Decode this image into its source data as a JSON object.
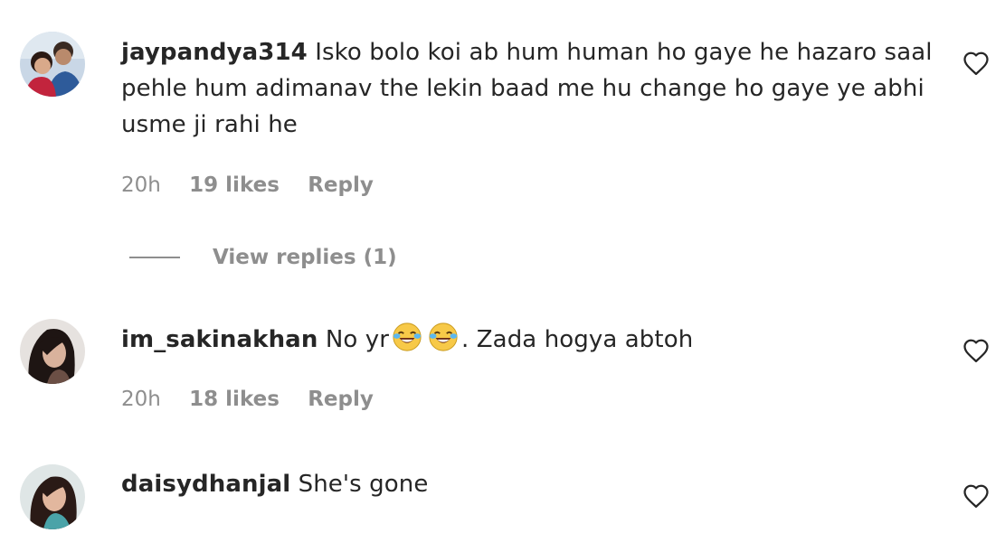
{
  "comments": [
    {
      "username": "jaypandya314",
      "text": "Isko bolo koi ab hum human ho gaye he hazaro saal pehle hum adimanav the lekin baad me hu change ho gaye ye abhi usme ji rahi he",
      "time": "20h",
      "likes": "19 likes",
      "reply": "Reply",
      "view_replies": "View replies (1)"
    },
    {
      "username": "im_sakinakhan",
      "text_before": "No yr",
      "emoji": "face-with-tears-of-joy",
      "text_after": ". Zada hogya abtoh",
      "time": "20h",
      "likes": "18 likes",
      "reply": "Reply"
    },
    {
      "username": "daisydhanjal",
      "text": "She's gone"
    }
  ],
  "icons": {
    "like": "heart-outline-icon"
  },
  "colors": {
    "primary_text": "#262626",
    "secondary_text": "#8e8e8e"
  }
}
